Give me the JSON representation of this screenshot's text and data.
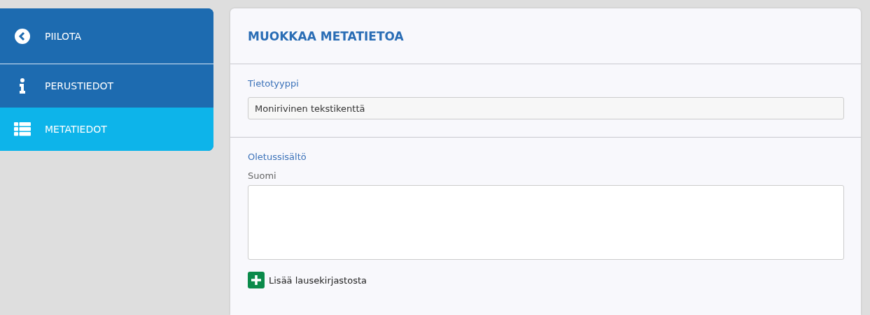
{
  "sidebar": {
    "items": [
      {
        "kind": "hide",
        "label": "PIILOTA",
        "selected": false
      },
      {
        "kind": "info",
        "label": "PERUSTIEDOT",
        "selected": false
      },
      {
        "kind": "list",
        "label": "METATIEDOT",
        "selected": true
      }
    ]
  },
  "panel": {
    "title": "MUOKKAA METATIETOA",
    "type_section": {
      "label": "Tietotyyppi",
      "value": "Monirivinen tekstikenttä"
    },
    "content_section": {
      "label": "Oletussisältö",
      "language_label": "Suomi",
      "add_button": "Lisää lausekirjastosta"
    }
  }
}
